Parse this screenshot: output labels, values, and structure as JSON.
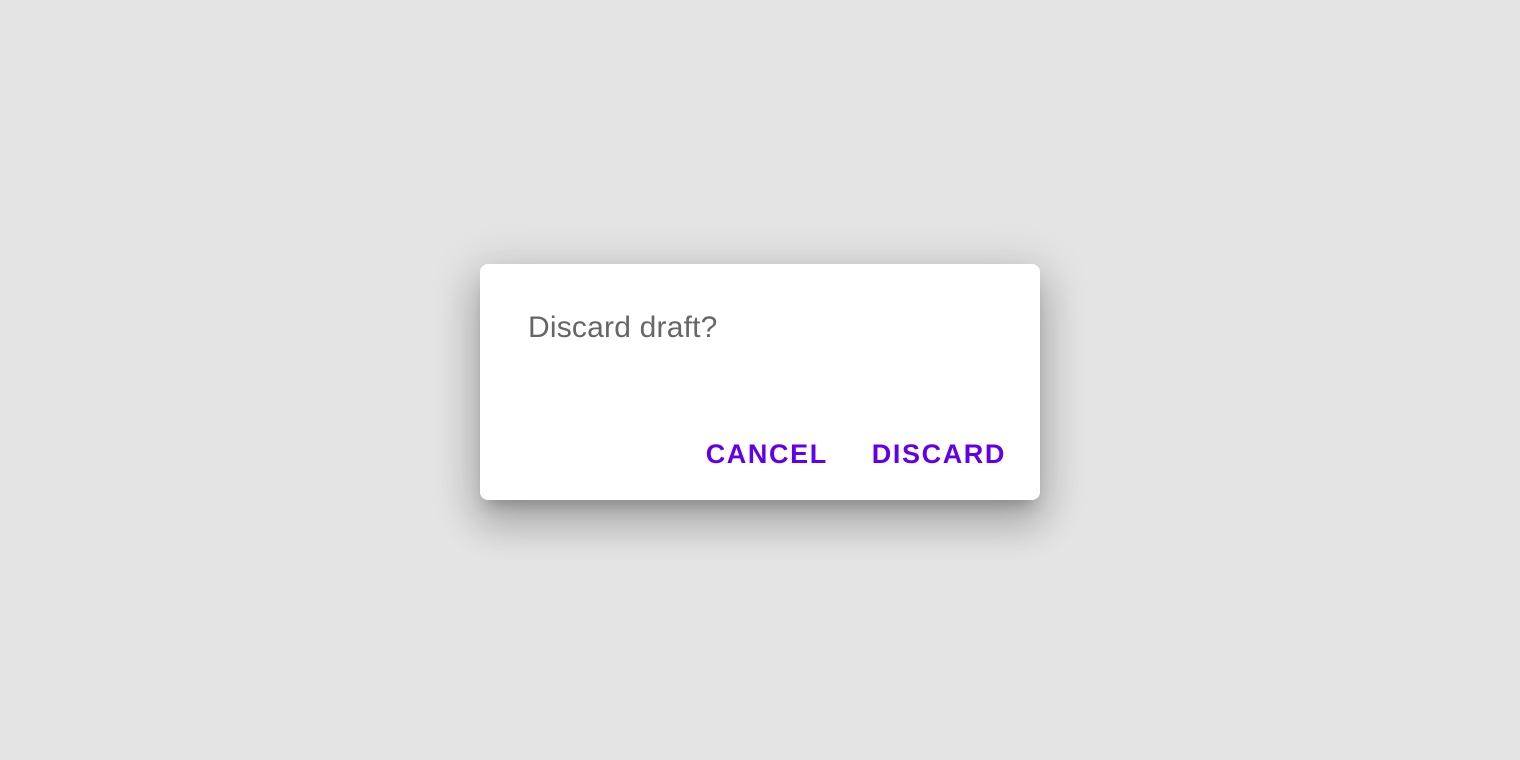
{
  "dialog": {
    "message": "Discard draft?",
    "actions": {
      "cancel_label": "CANCEL",
      "discard_label": "DISCARD"
    }
  },
  "colors": {
    "background": "#e4e4e4",
    "surface": "#ffffff",
    "message_text": "#666666",
    "accent": "#6200ee"
  }
}
